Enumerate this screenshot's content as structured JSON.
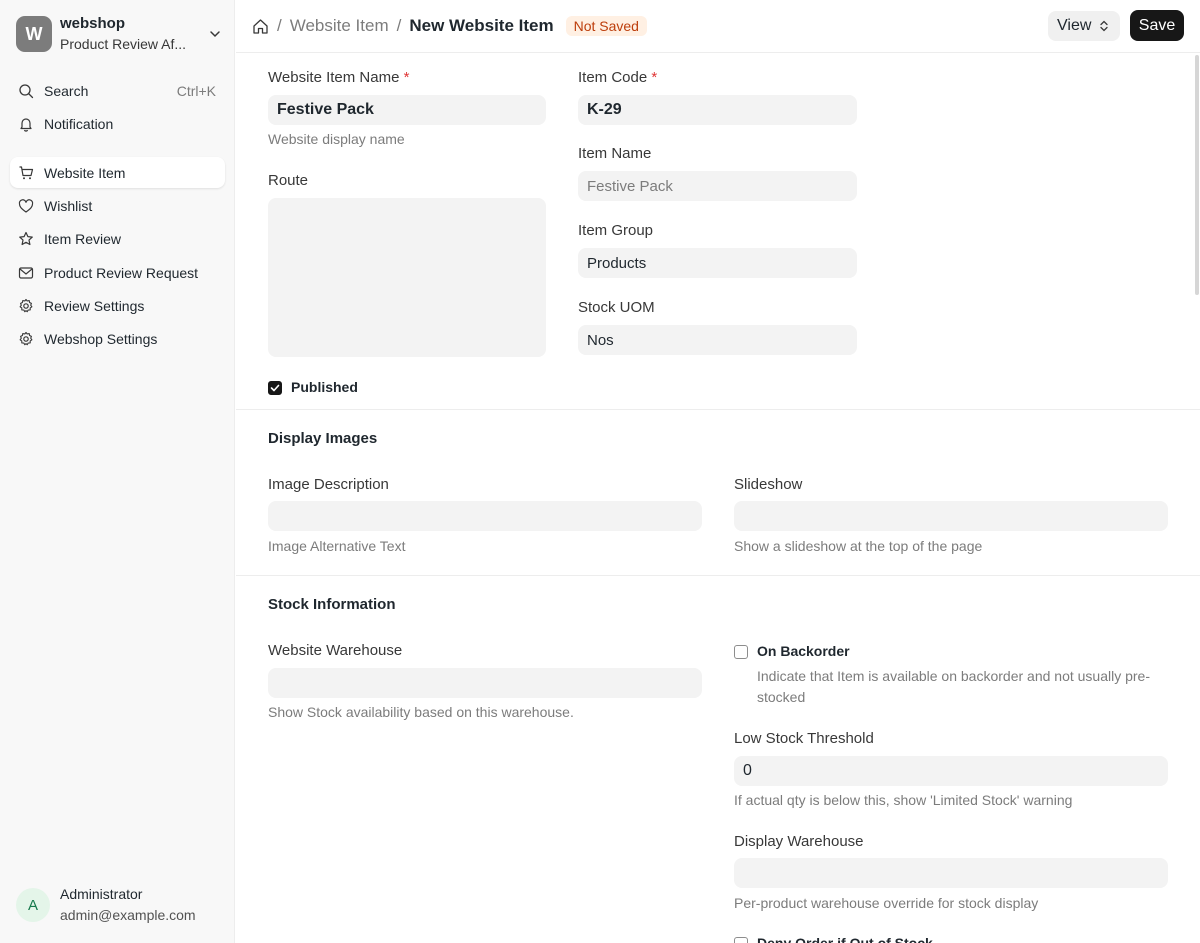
{
  "sidebar": {
    "workspace_initial": "W",
    "workspace_title": "webshop",
    "workspace_subtitle": "Product Review Af...",
    "search_label": "Search",
    "search_shortcut": "Ctrl+K",
    "notification_label": "Notification",
    "items": [
      {
        "label": "Website Item",
        "icon": "cart-icon",
        "active": true
      },
      {
        "label": "Wishlist",
        "icon": "heart-icon"
      },
      {
        "label": "Item Review",
        "icon": "star-icon"
      },
      {
        "label": "Product Review Request",
        "icon": "mail-icon"
      },
      {
        "label": "Review Settings",
        "icon": "gear-icon"
      },
      {
        "label": "Webshop Settings",
        "icon": "gear-icon"
      }
    ],
    "user": {
      "initial": "A",
      "name": "Administrator",
      "email": "admin@example.com"
    }
  },
  "header": {
    "breadcrumb": [
      "Website Item",
      "New Website Item"
    ],
    "status_badge": "Not Saved",
    "view_label": "View",
    "save_label": "Save"
  },
  "form": {
    "website_item_name": {
      "label": "Website Item Name",
      "required": "*",
      "value": "Festive Pack",
      "help": "Website display name"
    },
    "item_code": {
      "label": "Item Code",
      "required": "*",
      "value": "K-29"
    },
    "item_name": {
      "label": "Item Name",
      "value": "Festive Pack"
    },
    "route": {
      "label": "Route",
      "value": ""
    },
    "item_group": {
      "label": "Item Group",
      "value": "Products"
    },
    "stock_uom": {
      "label": "Stock UOM",
      "value": "Nos"
    },
    "published": {
      "label": "Published",
      "checked": true
    },
    "display_images": {
      "title": "Display Images",
      "image_description": {
        "label": "Image Description",
        "value": "",
        "help": "Image Alternative Text"
      },
      "slideshow": {
        "label": "Slideshow",
        "value": "",
        "help": "Show a slideshow at the top of the page"
      }
    },
    "stock_information": {
      "title": "Stock Information",
      "website_warehouse": {
        "label": "Website Warehouse",
        "value": "",
        "help": "Show Stock availability based on this warehouse."
      },
      "on_backorder": {
        "label": "On Backorder",
        "checked": false,
        "help": "Indicate that Item is available on backorder and not usually pre-stocked"
      },
      "low_stock_threshold": {
        "label": "Low Stock Threshold",
        "value": "0",
        "help": "If actual qty is below this, show 'Limited Stock' warning"
      },
      "display_warehouse": {
        "label": "Display Warehouse",
        "value": "",
        "help": "Per-product warehouse override for stock display"
      },
      "deny_order": {
        "label": "Deny Order if Out of Stock",
        "checked": false
      }
    }
  }
}
